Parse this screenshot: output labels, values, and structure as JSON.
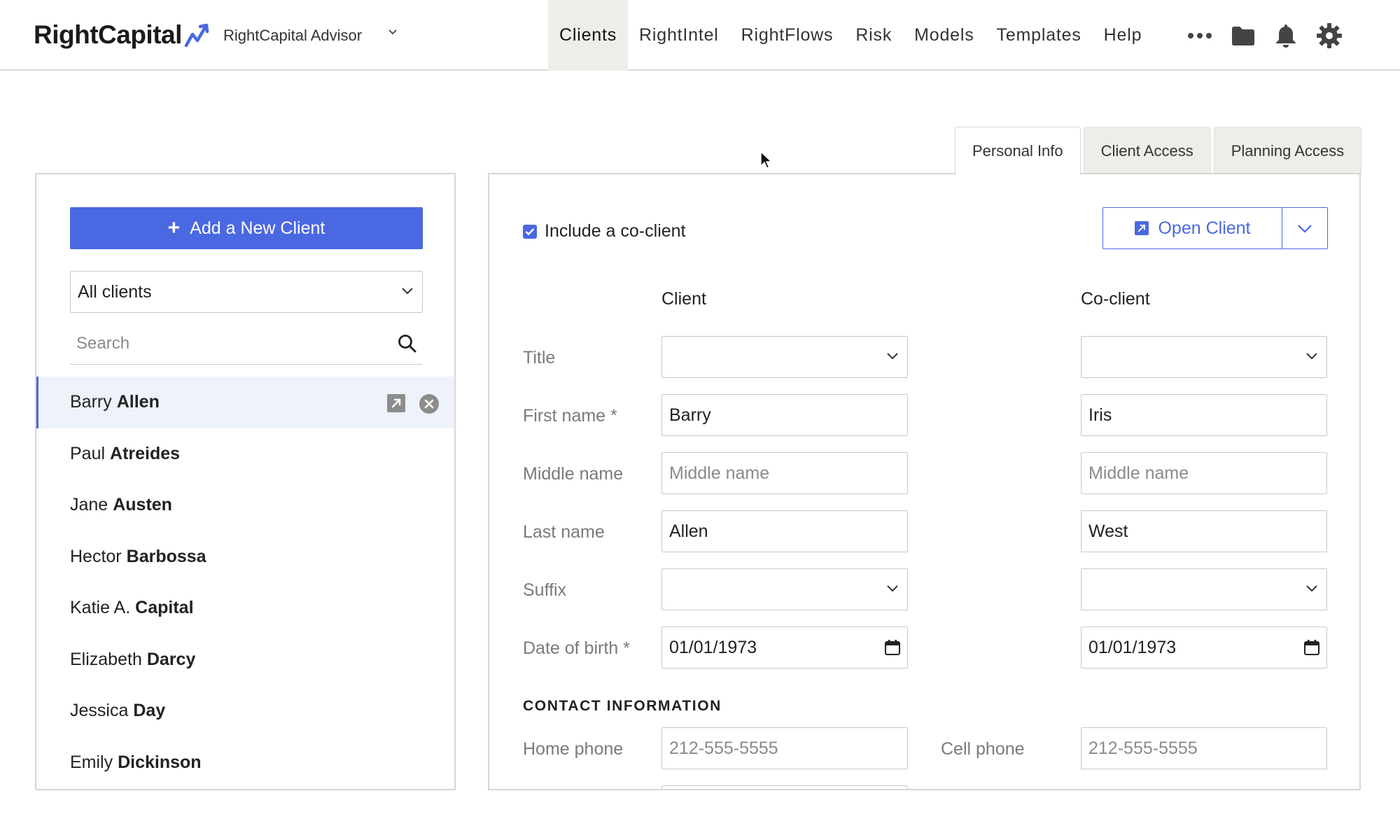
{
  "header": {
    "logo_text": "RightCapital",
    "account_label": "RightCapital Advisor",
    "nav": [
      "Clients",
      "RightIntel",
      "RightFlows",
      "Risk",
      "Models",
      "Templates",
      "Help"
    ],
    "active_nav": "Clients",
    "icons": [
      "more-icon",
      "folder-icon",
      "bell-icon",
      "gear-icon"
    ],
    "brand_color": "#4b68e3"
  },
  "sidebar": {
    "add_button_label": "Add a New Client",
    "filter_value": "All clients",
    "search_placeholder": "Search",
    "clients": [
      {
        "first": "Barry",
        "last": "Allen",
        "selected": true
      },
      {
        "first": "Paul",
        "last": "Atreides"
      },
      {
        "first": "Jane",
        "last": "Austen"
      },
      {
        "first": "Hector",
        "last": "Barbossa"
      },
      {
        "first": "Katie A.",
        "last": "Capital"
      },
      {
        "first": "Elizabeth",
        "last": "Darcy"
      },
      {
        "first": "Jessica",
        "last": "Day"
      },
      {
        "first": "Emily",
        "last": "Dickinson"
      }
    ]
  },
  "tabs": [
    "Personal Info",
    "Client Access",
    "Planning Access"
  ],
  "active_tab": "Personal Info",
  "form": {
    "include_coclient_label": "Include a co-client",
    "include_coclient_checked": true,
    "open_client_label": "Open Client",
    "client_heading": "Client",
    "coclient_heading": "Co-client",
    "labels": {
      "title": "Title",
      "first_name": "First name *",
      "middle_name": "Middle name",
      "last_name": "Last name",
      "suffix": "Suffix",
      "dob": "Date of birth *"
    },
    "client": {
      "title": "",
      "first_name": "Barry",
      "middle_name_placeholder": "Middle name",
      "last_name": "Allen",
      "suffix": "",
      "dob": "01/01/1973"
    },
    "coclient": {
      "title": "",
      "first_name": "Iris",
      "middle_name_placeholder": "Middle name",
      "last_name": "West",
      "suffix": "",
      "dob": "01/01/1973"
    },
    "contact_section_title": "CONTACT INFORMATION",
    "home_phone_label": "Home phone",
    "home_phone_placeholder": "212-555-5555",
    "cell_phone_label": "Cell phone",
    "cell_phone_placeholder": "212-555-5555"
  }
}
